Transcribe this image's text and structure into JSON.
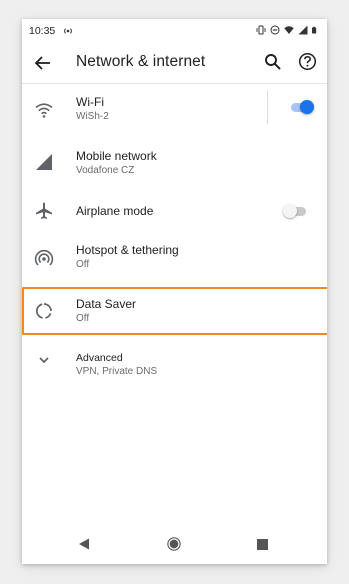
{
  "status_bar": {
    "time": "10:35"
  },
  "toolbar": {
    "title": "Network & internet"
  },
  "rows": [
    {
      "title": "Wi-Fi",
      "subtitle": "WiSh-2",
      "icon": "wifi-icon",
      "toggle": "on"
    },
    {
      "title": "Mobile network",
      "subtitle": "Vodafone CZ",
      "icon": "signal-icon"
    },
    {
      "title": "Airplane mode",
      "subtitle": "",
      "icon": "airplane-icon",
      "toggle": "off"
    },
    {
      "title": "Hotspot & tethering",
      "subtitle": "Off",
      "icon": "hotspot-icon"
    },
    {
      "title": "Data Saver",
      "subtitle": "Off",
      "icon": "data-saver-icon",
      "highlighted": true
    },
    {
      "title": "Advanced",
      "subtitle": "VPN, Private DNS",
      "icon": "chevron-down-icon"
    }
  ],
  "colors": {
    "accent": "#1a73e8",
    "highlight": "#f08a24",
    "icon_gray": "#5f6368"
  }
}
